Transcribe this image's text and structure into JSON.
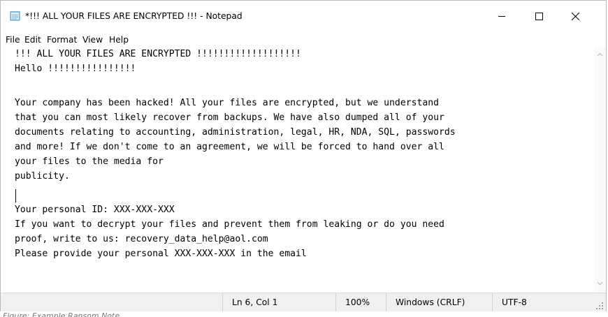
{
  "window": {
    "title": "*!!! ALL YOUR FILES ARE ENCRYPTED !!! - Notepad",
    "icon": "notepad-icon",
    "controls": {
      "minimize": "minimize-icon",
      "maximize": "maximize-icon",
      "close": "close-icon"
    }
  },
  "menu": {
    "items": [
      "File",
      "Edit",
      "Format",
      "View",
      "Help"
    ]
  },
  "document": {
    "lines": [
      "!!! ALL YOUR FILES ARE ENCRYPTED !!!!!!!!!!!!!!!!!!!",
      "Hello !!!!!!!!!!!!!!!!",
      "",
      "Your company has been hacked! All your files are encrypted, but we understand",
      "that you can most likely recover from backups. We have also dumped all of your",
      "documents relating to accounting, administration, legal, HR, NDA, SQL, passwords",
      "and more! If we don't come to an agreement, we will be forced to hand over all",
      "your files to the media for",
      "publicity.",
      "",
      "Your personal ID: XXX-XXX-XXX",
      "If you want to decrypt your files and prevent them from leaking or do you need",
      "proof, write to us: recovery_data_help@aol.com",
      "Please provide your personal XXX-XXX-XXX in the email"
    ]
  },
  "status": {
    "position": "Ln 6, Col 1",
    "zoom": "100%",
    "line_ending": "Windows (CRLF)",
    "encoding": "UTF-8"
  },
  "caption": "Figure: Example Ransom Note"
}
